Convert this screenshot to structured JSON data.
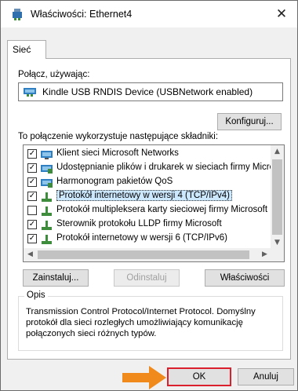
{
  "window": {
    "title": "Właściwości: Ethernet4",
    "close_glyph": "✕"
  },
  "tabs": [
    {
      "label": "Sieć"
    }
  ],
  "connect_using": {
    "label": "Połącz, używając:",
    "device_name": "Kindle USB RNDIS Device (USBNetwork enabled)",
    "configure_button": "Konfiguruj..."
  },
  "components": {
    "label": "To połączenie wykorzystuje następujące składniki:",
    "items": [
      {
        "label": "Klient sieci Microsoft Networks",
        "checked": true,
        "icon": "network-client-icon",
        "selected": false
      },
      {
        "label": "Udostępnianie plików i drukarek w sieciach firmy Micros",
        "checked": true,
        "icon": "network-service-icon",
        "selected": false
      },
      {
        "label": "Harmonogram pakietów QoS",
        "checked": true,
        "icon": "network-service-icon",
        "selected": false
      },
      {
        "label": "Protokół internetowy w wersji 4 (TCP/IPv4)",
        "checked": true,
        "icon": "protocol-icon",
        "selected": true
      },
      {
        "label": "Protokół multipleksera karty sieciowej firmy Microsoft",
        "checked": false,
        "icon": "protocol-icon",
        "selected": false
      },
      {
        "label": "Sterownik protokołu LLDP firmy Microsoft",
        "checked": true,
        "icon": "protocol-icon",
        "selected": false
      },
      {
        "label": "Protokół internetowy w wersji 6 (TCP/IPv6)",
        "checked": true,
        "icon": "protocol-icon",
        "selected": false
      }
    ],
    "check_glyph": "✓"
  },
  "actions": {
    "install": "Zainstaluj...",
    "uninstall": "Odinstaluj",
    "properties": "Właściwości"
  },
  "description": {
    "title": "Opis",
    "text": "Transmission Control Protocol/Internet Protocol. Domyślny protokół dla sieci rozległych umożliwiający komunikację połączonych sieci różnych typów."
  },
  "footer": {
    "ok": "OK",
    "cancel": "Anuluj"
  },
  "colors": {
    "highlight_box": "#d9202c",
    "arrow": "#f08a1c",
    "selection": "#cce8ff"
  }
}
